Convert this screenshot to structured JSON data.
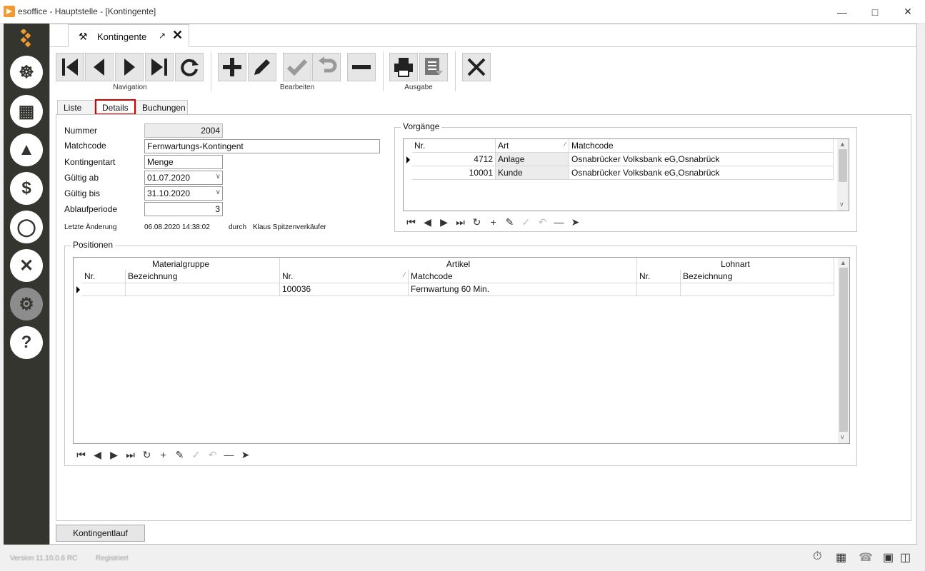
{
  "window": {
    "title": "esoffice - Hauptstelle - [Kontingente]"
  },
  "doc_tab": {
    "label": "Kontingente"
  },
  "toolbar": {
    "groups": {
      "navigation": "Navigation",
      "edit": "Bearbeiten",
      "output": "Ausgabe"
    }
  },
  "tabs": [
    "Liste",
    "Details",
    "Buchungen"
  ],
  "form": {
    "nummer": {
      "label": "Nummer",
      "value": "2004"
    },
    "matchcode": {
      "label": "Matchcode",
      "value": "Fernwartungs-Kontingent"
    },
    "kontingentart": {
      "label": "Kontingentart",
      "value": "Menge"
    },
    "gueltig_ab": {
      "label": "Gültig ab",
      "value": "01.07.2020"
    },
    "gueltig_bis": {
      "label": "Gültig bis",
      "value": "31.10.2020"
    },
    "ablaufperiode": {
      "label": "Ablaufperiode",
      "value": "3"
    },
    "last_change": {
      "label": "Letzte Änderung",
      "date": "06.08.2020 14:38:02",
      "by_label": "durch",
      "user": "Klaus Spitzenverkäufer"
    }
  },
  "vorgaenge": {
    "title": "Vorgänge",
    "columns": [
      "Nr.",
      "Art",
      "Matchcode"
    ],
    "rows": [
      {
        "nr": "4712",
        "art": "Anlage",
        "matchcode": "Osnabrücker Volksbank eG,Osnabrück"
      },
      {
        "nr": "10001",
        "art": "Kunde",
        "matchcode": "Osnabrücker Volksbank eG,Osnabrück"
      }
    ]
  },
  "positionen": {
    "title": "Positionen",
    "bands": [
      "Materialgruppe",
      "Artikel",
      "Lohnart"
    ],
    "columns": [
      "Nr.",
      "Bezeichnung",
      "Nr.",
      "Matchcode",
      "Nr.",
      "Bezeichnung"
    ],
    "rows": [
      {
        "mg_nr": "",
        "mg_bez": "",
        "art_nr": "100036",
        "art_match": "Fernwartung 60 Min.",
        "lohn_nr": "",
        "lohn_bez": ""
      }
    ]
  },
  "footer": {
    "button": "Kontingentlauf"
  },
  "status": {
    "version": "Version 11.10.0.6 RC",
    "registered": "Registriert"
  }
}
